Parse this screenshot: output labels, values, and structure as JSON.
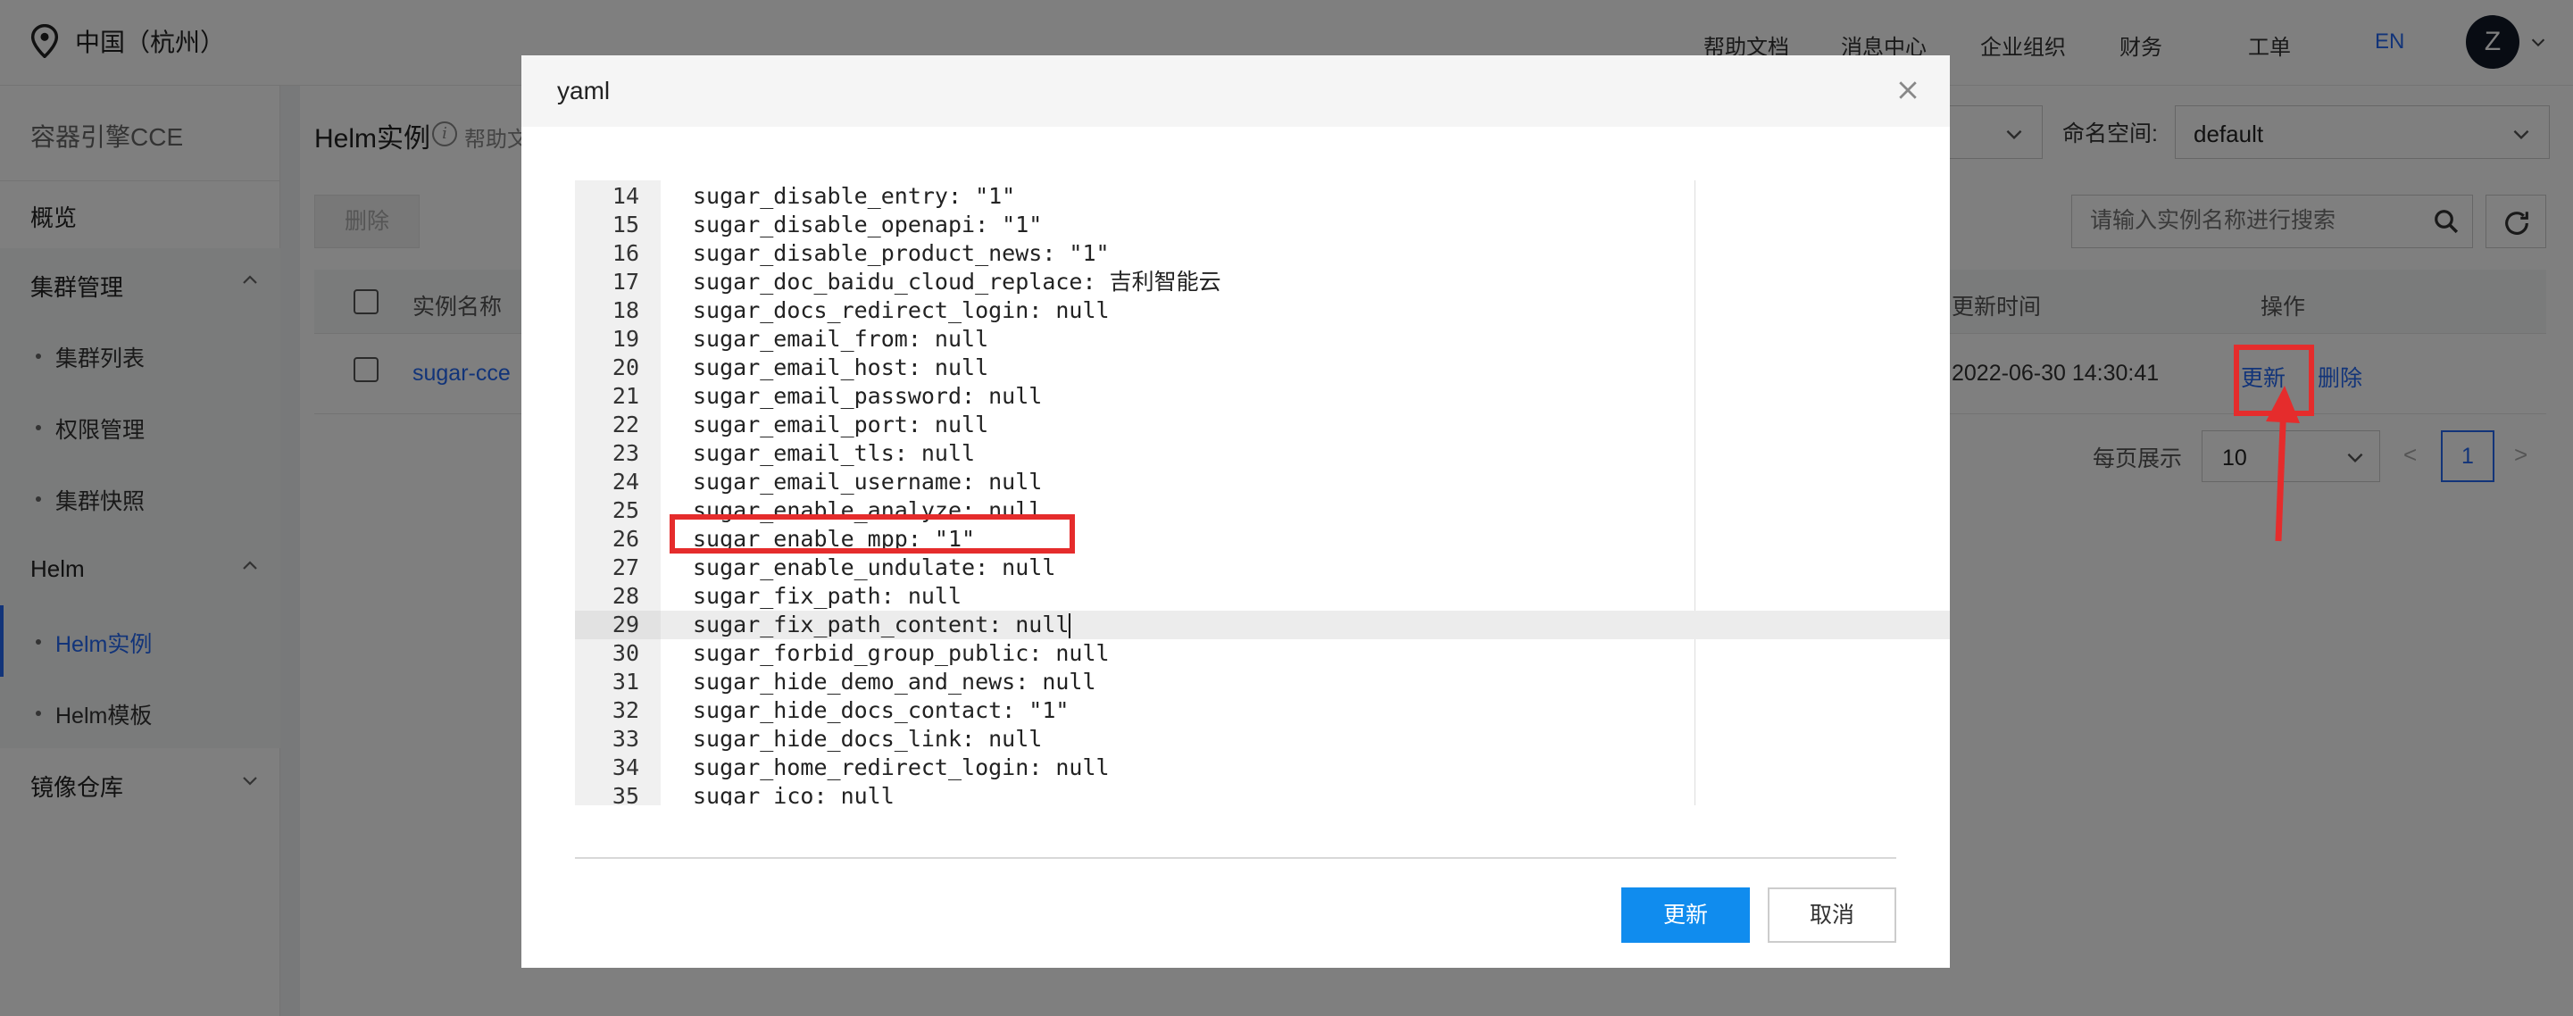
{
  "header": {
    "region": "中国（杭州）",
    "nav": [
      "帮助文档",
      "消息中心",
      "企业组织",
      "财务",
      "工单",
      "EN"
    ],
    "avatar_initial": "Z"
  },
  "sidebar": {
    "title": "容器引擎CCE",
    "overview": "概览",
    "groups": [
      {
        "label": "集群管理",
        "items": [
          "集群列表",
          "权限管理",
          "集群快照"
        ]
      },
      {
        "label": "Helm",
        "items": [
          "Helm实例",
          "Helm模板"
        ]
      },
      {
        "label": "镜像仓库",
        "items": []
      }
    ],
    "active_item": "Helm实例"
  },
  "main": {
    "title": "Helm实例",
    "help_text": "帮助文",
    "namespace_label": "命名空间:",
    "namespace_value": "default",
    "delete_button": "删除",
    "search_placeholder": "请输入实例名称进行搜索",
    "table": {
      "headers": [
        "实例名称",
        "更新时间",
        "操作"
      ],
      "rows": [
        {
          "name": "sugar-cce",
          "updated": "2022-06-30 14:30:41",
          "actions": [
            "更新",
            "删除"
          ]
        }
      ]
    },
    "pager": {
      "label": "每页展示",
      "page_size": "10",
      "prev": "<",
      "page": "1",
      "next": ">"
    }
  },
  "dialog": {
    "title": "yaml",
    "close_glyph": "×",
    "lines": [
      {
        "n": "14",
        "code": "sugar_disable_entry: \"1\""
      },
      {
        "n": "15",
        "code": "sugar_disable_openapi: \"1\""
      },
      {
        "n": "16",
        "code": "sugar_disable_product_news: \"1\""
      },
      {
        "n": "17",
        "code": "sugar_doc_baidu_cloud_replace: 吉利智能云"
      },
      {
        "n": "18",
        "code": "sugar_docs_redirect_login: null"
      },
      {
        "n": "19",
        "code": "sugar_email_from: null"
      },
      {
        "n": "20",
        "code": "sugar_email_host: null"
      },
      {
        "n": "21",
        "code": "sugar_email_password: null"
      },
      {
        "n": "22",
        "code": "sugar_email_port: null"
      },
      {
        "n": "23",
        "code": "sugar_email_tls: null"
      },
      {
        "n": "24",
        "code": "sugar_email_username: null"
      },
      {
        "n": "25",
        "code": "sugar_enable_analyze: null"
      },
      {
        "n": "26",
        "code": "sugar_enable_mpp: \"1\""
      },
      {
        "n": "27",
        "code": "sugar_enable_undulate: null"
      },
      {
        "n": "28",
        "code": "sugar_fix_path: null"
      },
      {
        "n": "29",
        "code": "sugar_fix_path_content: null"
      },
      {
        "n": "30",
        "code": "sugar_forbid_group_public: null"
      },
      {
        "n": "31",
        "code": "sugar_hide_demo_and_news: null"
      },
      {
        "n": "32",
        "code": "sugar_hide_docs_contact: \"1\""
      },
      {
        "n": "33",
        "code": "sugar_hide_docs_link: null"
      },
      {
        "n": "34",
        "code": "sugar_home_redirect_login: null"
      },
      {
        "n": "35",
        "code": "sugar_ico: null"
      }
    ],
    "active_line": "29",
    "highlighted_line": "26",
    "confirm_button": "更新",
    "cancel_button": "取消"
  },
  "colors": {
    "accent": "#2468f2",
    "primary_button": "#108cee",
    "annotation": "#e52c2c"
  }
}
